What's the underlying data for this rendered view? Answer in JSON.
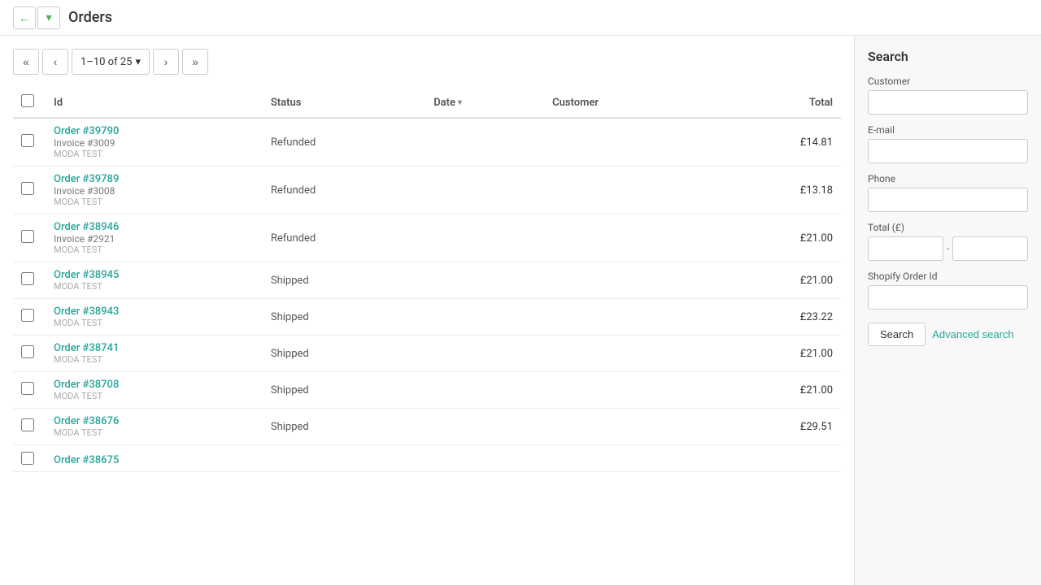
{
  "header": {
    "title": "Orders",
    "back_btn": "←",
    "dropdown_btn": "▾"
  },
  "pagination": {
    "first_btn": "«",
    "prev_btn": "‹",
    "range_label": "1–10 of 25",
    "range_dropdown_icon": "▾",
    "next_btn": "›",
    "last_btn": "»"
  },
  "table": {
    "columns": [
      "",
      "Id",
      "Status",
      "Date",
      "Customer",
      "Total"
    ],
    "date_sort_icon": "▾",
    "rows": [
      {
        "order": "Order #39790",
        "invoice": "Invoice #3009",
        "store": "MODA TEST",
        "status": "Refunded",
        "customer": "",
        "total": "£14.81"
      },
      {
        "order": "Order #39789",
        "invoice": "Invoice #3008",
        "store": "MODA TEST",
        "status": "Refunded",
        "customer": "",
        "total": "£13.18"
      },
      {
        "order": "Order #38946",
        "invoice": "Invoice #2921",
        "store": "MODA TEST",
        "status": "Refunded",
        "customer": "",
        "total": "£21.00"
      },
      {
        "order": "Order #38945",
        "invoice": "",
        "store": "MODA TEST",
        "status": "Shipped",
        "customer": "",
        "total": "£21.00"
      },
      {
        "order": "Order #38943",
        "invoice": "",
        "store": "MODA TEST",
        "status": "Shipped",
        "customer": "",
        "total": "£23.22"
      },
      {
        "order": "Order #38741",
        "invoice": "",
        "store": "MODA TEST",
        "status": "Shipped",
        "customer": "",
        "total": "£21.00"
      },
      {
        "order": "Order #38708",
        "invoice": "",
        "store": "MODA TEST",
        "status": "Shipped",
        "customer": "",
        "total": "£21.00"
      },
      {
        "order": "Order #38676",
        "invoice": "",
        "store": "MODA TEST",
        "status": "Shipped",
        "customer": "",
        "total": "£29.51"
      },
      {
        "order": "Order #38675",
        "invoice": "",
        "store": "",
        "status": "",
        "customer": "",
        "total": ""
      }
    ]
  },
  "search_panel": {
    "title": "Search",
    "customer_label": "Customer",
    "customer_placeholder": "",
    "email_label": "E-mail",
    "email_placeholder": "",
    "phone_label": "Phone",
    "phone_placeholder": "",
    "total_label": "Total (£)",
    "total_min_placeholder": "",
    "total_max_placeholder": "",
    "shopify_label": "Shopify Order Id",
    "shopify_placeholder": "",
    "search_btn": "Search",
    "advanced_btn": "Advanced search"
  }
}
